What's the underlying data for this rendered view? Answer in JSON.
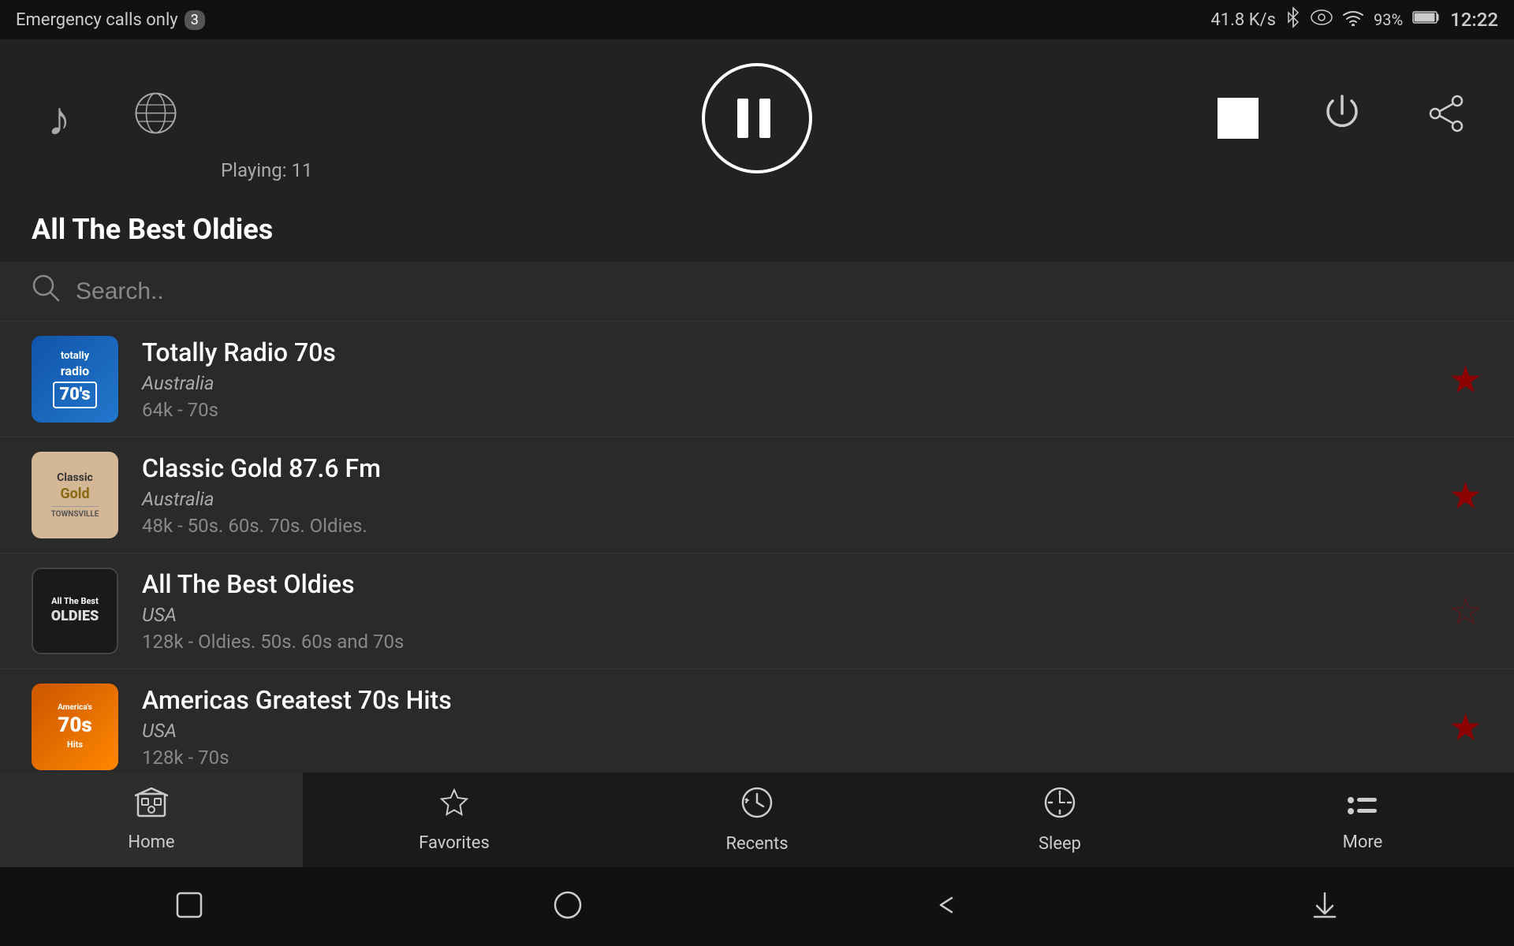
{
  "statusBar": {
    "emergencyText": "Emergency calls only",
    "badge": "3",
    "speed": "41.8 K/s",
    "batteryLevel": "93%",
    "time": "12:22"
  },
  "player": {
    "playingLabel": "Playing: 11",
    "pauseTitle": "Pause",
    "stopTitle": "Stop",
    "powerTitle": "Power",
    "shareTitle": "Share"
  },
  "nowPlaying": {
    "title": "All The Best Oldies"
  },
  "search": {
    "placeholder": "Search.."
  },
  "stations": [
    {
      "name": "Totally Radio 70s",
      "country": "Australia",
      "bitrate": "64k - 70s",
      "favorited": true,
      "logoType": "70s",
      "logoText": "totally\nradio\n70's"
    },
    {
      "name": "Classic Gold 87.6 Fm",
      "country": "Australia",
      "bitrate": "48k - 50s. 60s. 70s. Oldies.",
      "favorited": true,
      "logoType": "classic",
      "logoText": "Classic\nGold\nTOWNSVILLE"
    },
    {
      "name": "All The Best Oldies",
      "country": "USA",
      "bitrate": "128k - Oldies. 50s. 60s and 70s",
      "favorited": false,
      "logoType": "oldies",
      "logoText": "All The Best\nOLDIES"
    },
    {
      "name": "Americas Greatest 70s Hits",
      "country": "USA",
      "bitrate": "128k - 70s",
      "favorited": true,
      "logoType": "americas",
      "logoText": "America's\n70s\nHits"
    }
  ],
  "bottomNav": [
    {
      "id": "home",
      "label": "Home",
      "icon": "home",
      "active": true
    },
    {
      "id": "favorites",
      "label": "Favorites",
      "icon": "star",
      "active": false
    },
    {
      "id": "recents",
      "label": "Recents",
      "icon": "recents",
      "active": false
    },
    {
      "id": "sleep",
      "label": "Sleep",
      "icon": "sleep",
      "active": false
    },
    {
      "id": "more",
      "label": "More",
      "icon": "more",
      "active": false
    }
  ],
  "sysNav": {
    "squareTitle": "Recent apps",
    "circleTitle": "Home",
    "backTitle": "Back",
    "downloadTitle": "Downloads"
  }
}
